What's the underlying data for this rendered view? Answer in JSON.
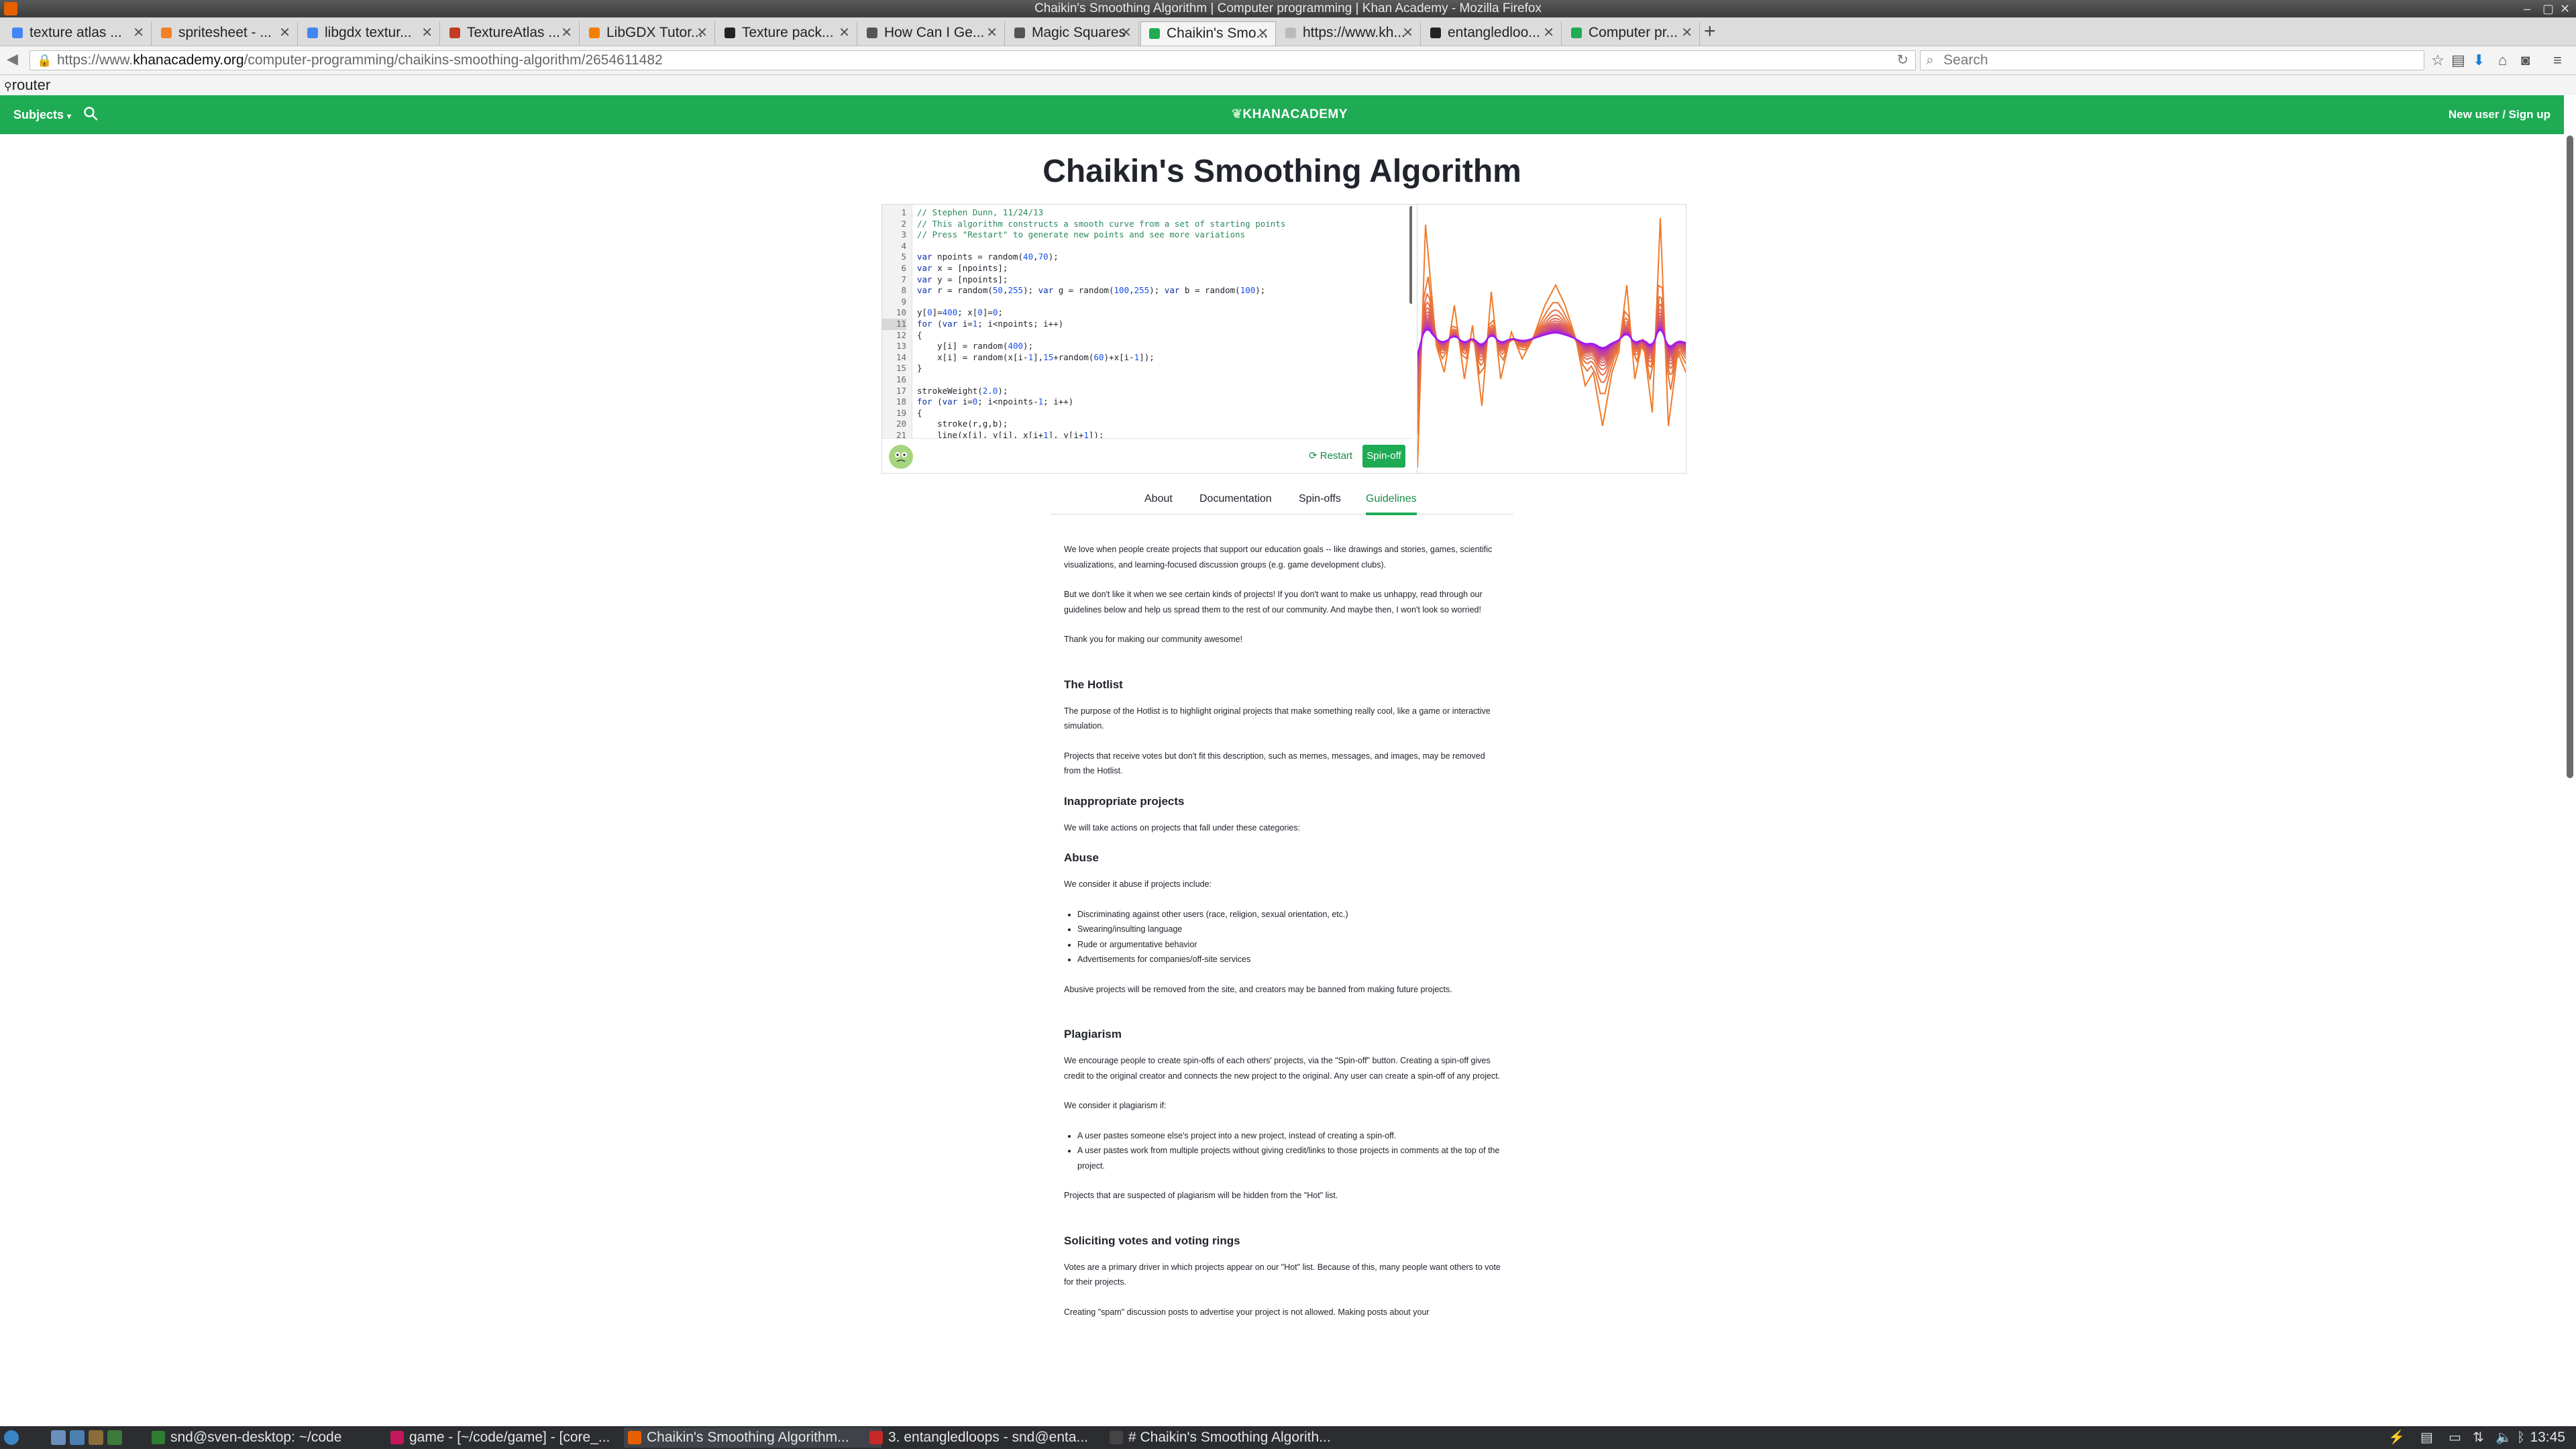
{
  "window": {
    "title": "Chaikin's Smoothing Algorithm | Computer programming | Khan Academy - Mozilla Firefox"
  },
  "browser_tabs": [
    {
      "label": "texture atlas ...",
      "icon": "google-icon"
    },
    {
      "label": "spritesheet - ...",
      "icon": "stackoverflow-icon"
    },
    {
      "label": "libgdx textur...",
      "icon": "google-icon"
    },
    {
      "label": "TextureAtlas ...",
      "icon": "libgdx-icon"
    },
    {
      "label": "LibGDX Tutor...",
      "icon": "blogger-icon"
    },
    {
      "label": "Texture pack...",
      "icon": "github-icon"
    },
    {
      "label": "How Can I Ge...",
      "icon": "page-icon"
    },
    {
      "label": "Magic Squares",
      "icon": "page-icon"
    },
    {
      "label": "Chaikin's Smo...",
      "icon": "khan-leaf-icon",
      "active": true
    },
    {
      "label": "https://www.kh...",
      "icon": "blank-icon"
    },
    {
      "label": "entangledloo...",
      "icon": "github-icon"
    },
    {
      "label": "Computer pr...",
      "icon": "khan-leaf-icon"
    }
  ],
  "address": {
    "prefix": "https://www.",
    "host": "khanacademy.org",
    "path": "/computer-programming/chaikins-smoothing-algorithm/2654611482"
  },
  "search": {
    "placeholder": "Search"
  },
  "bookmarks": {
    "item": "router"
  },
  "ka_header": {
    "subjects": "Subjects",
    "logo": "KHANACADEMY",
    "signup": "New user / Sign up"
  },
  "page_title": "Chaikin's Smoothing Algorithm",
  "code_lines": [
    {
      "n": "1",
      "html": "<span class='c-comment'>// Stephen Dunn, 11/24/13</span>"
    },
    {
      "n": "2",
      "html": "<span class='c-comment'>// This algorithm constructs a smooth curve from a set of starting points</span>"
    },
    {
      "n": "3",
      "html": "<span class='c-comment'>// Press \"Restart\" to generate new points and see more variations</span>"
    },
    {
      "n": "4",
      "html": ""
    },
    {
      "n": "5",
      "html": "<span class='c-kw'>var</span> npoints = random(<span class='c-num'>40</span>,<span class='c-num'>70</span>);"
    },
    {
      "n": "6",
      "html": "<span class='c-kw'>var</span> x = [npoints];"
    },
    {
      "n": "7",
      "html": "<span class='c-kw'>var</span> y = [npoints];"
    },
    {
      "n": "8",
      "html": "<span class='c-kw'>var</span> r = random(<span class='c-num'>50</span>,<span class='c-num'>255</span>); <span class='c-kw'>var</span> g = random(<span class='c-num'>100</span>,<span class='c-num'>255</span>); <span class='c-kw'>var</span> b = random(<span class='c-num'>100</span>);"
    },
    {
      "n": "9",
      "html": ""
    },
    {
      "n": "10",
      "html": "y[<span class='c-num'>0</span>]=<span class='c-num'>400</span>; x[<span class='c-num'>0</span>]=<span class='c-num'>0</span>;"
    },
    {
      "n": "11",
      "html": "<span class='c-kw'>for</span> (<span class='c-kw'>var</span> i=<span class='c-num'>1</span>; i&lt;npoints; i++)",
      "hl": true
    },
    {
      "n": "12",
      "html": "{"
    },
    {
      "n": "13",
      "html": "    y[i] = random(<span class='c-num'>400</span>);"
    },
    {
      "n": "14",
      "html": "    x[i] = random(x[i-<span class='c-num'>1</span>],<span class='c-num'>15</span>+random(<span class='c-num'>60</span>)+x[i-<span class='c-num'>1</span>]);"
    },
    {
      "n": "15",
      "html": "}"
    },
    {
      "n": "16",
      "html": ""
    },
    {
      "n": "17",
      "html": "strokeWeight(<span class='c-num'>2.0</span>);"
    },
    {
      "n": "18",
      "html": "<span class='c-kw'>for</span> (<span class='c-kw'>var</span> i=<span class='c-num'>0</span>; i&lt;npoints-<span class='c-num'>1</span>; i++)"
    },
    {
      "n": "19",
      "html": "{"
    },
    {
      "n": "20",
      "html": "    stroke(r,g,b);"
    },
    {
      "n": "21",
      "html": "    line(x[i], y[i], x[i+<span class='c-num'>1</span>], y[i+<span class='c-num'>1</span>]);"
    }
  ],
  "editor": {
    "restart": "Restart",
    "spinoff": "Spin-off"
  },
  "page_tabs": [
    {
      "label": "About"
    },
    {
      "label": "Documentation"
    },
    {
      "label": "Spin-offs"
    },
    {
      "label": "Guidelines",
      "active": true
    }
  ],
  "guidelines": {
    "intro1": "We love when people create projects that support our education goals -- like drawings and stories, games, scientific visualizations, and learning-focused discussion groups (e.g. game development clubs).",
    "intro2": "But we don't like it when we see certain kinds of projects! If you don't want to make us unhappy, read through our guidelines below and help us spread them to the rest of our community. And maybe then, I won't look so worried!",
    "intro3": "Thank you for making our community awesome!",
    "hotlist_title": "The Hotlist",
    "hotlist1": "The purpose of the Hotlist is to highlight original projects that make something really cool, like a game or interactive simulation.",
    "hotlist2": "Projects that receive votes but don't fit this description, such as memes, messages, and images, may be removed from the Hotlist.",
    "inappropriate_title": "Inappropriate projects",
    "inappropriate1": "We will take actions on projects that fall under these categories:",
    "abuse_title": "Abuse",
    "abuse1": "We consider it abuse if projects include:",
    "abuse_items": [
      "Discriminating against other users (race, religion, sexual orientation, etc.)",
      "Swearing/insulting language",
      "Rude or argumentative behavior",
      "Advertisements for companies/off-site services"
    ],
    "abuse2": "Abusive projects will be removed from the site, and creators may be banned from making future projects.",
    "plagiarism_title": "Plagiarism",
    "plag1": "We encourage people to create spin-offs of each others' projects, via the \"Spin-off\" button. Creating a spin-off gives credit to the original creator and connects the new project to the original. Any user can create a spin-off of any project.",
    "plag2": "We consider it plagiarism if:",
    "plag_items": [
      "A user pastes someone else's project into a new project, instead of creating a spin-off.",
      "A user pastes work from multiple projects without giving credit/links to those projects in comments at the top of the project."
    ],
    "plag3": "Projects that are suspected of plagiarism will be hidden from the \"Hot\" list.",
    "soliciting_title": "Soliciting votes and voting rings",
    "sol1": "Votes are a primary driver in which projects appear on our \"Hot\" list. Because of this, many people want others to vote for their projects.",
    "sol2": "Creating \"spam\" discussion posts to advertise your project is not allowed. Making posts about your"
  },
  "taskbar": {
    "items": [
      {
        "label": "snd@sven-desktop: ~/code",
        "icon": "terminal-icon"
      },
      {
        "label": "game - [~/code/game] - [core_...",
        "icon": "intellij-icon"
      },
      {
        "label": "Chaikin's Smoothing Algorithm...",
        "icon": "firefox-icon",
        "active": true
      },
      {
        "label": "3. entangledloops - snd@enta...",
        "icon": "terminal-red-icon"
      },
      {
        "label": "# Chaikin's Smoothing Algorith...",
        "icon": "editor-icon"
      }
    ],
    "clock": "13:45"
  },
  "colors": {
    "ka_green": "#1fab54",
    "curve_orange": "#f07a2a",
    "curve_purple": "#a020f0"
  }
}
